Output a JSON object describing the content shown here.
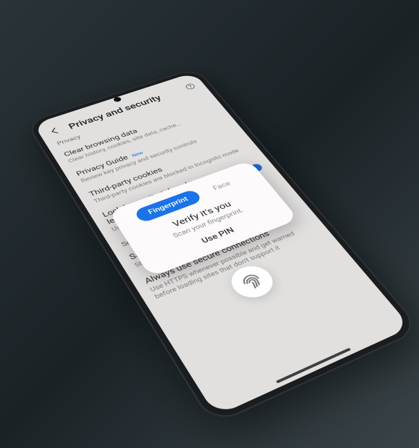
{
  "header": {
    "title": "Privacy and security",
    "breadcrumb": "Privacy"
  },
  "items": {
    "clear": {
      "title": "Clear browsing data",
      "sub": "Clear history, cookies, site data, cache…"
    },
    "guide": {
      "title": "Privacy Guide",
      "badge": "New",
      "sub": "Review key privacy and security controls"
    },
    "cookies": {
      "title": "Third-party cookies",
      "sub": "Third-party cookies are blocked in Incognito mode"
    },
    "lock": {
      "title": "Lock Incognito tabs when you leave Chrome",
      "sub": "Use screen lock to see open Incognito tabs"
    },
    "safe": {
      "title": "Safe Browsing",
      "sub": "Standard protection is on"
    },
    "https": {
      "title": "Always use secure connections",
      "sub": "Use HTTPS whenever possible and get warned before loading sites that don't support it"
    }
  },
  "section": {
    "security": "Security"
  },
  "modal": {
    "tab_fingerprint": "Fingerprint",
    "tab_face": "Face",
    "title": "Verify it's you",
    "sub": "Scan your fingerprint.",
    "use_pin": "Use PIN"
  }
}
